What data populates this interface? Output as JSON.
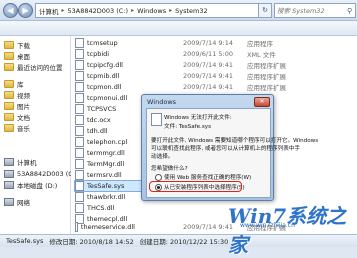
{
  "address": {
    "crumbs": [
      "计算机",
      "53A8842D003 (C:)",
      "Windows",
      "System32"
    ],
    "search_placeholder": "搜索 System32"
  },
  "nav": {
    "items": [
      {
        "label": "下载",
        "type": "folder"
      },
      {
        "label": "桌面",
        "type": "folder"
      },
      {
        "label": "最近访问的位置",
        "type": "folder"
      },
      {
        "label": "库",
        "type": "folder"
      },
      {
        "label": "视频",
        "type": "folder"
      },
      {
        "label": "图片",
        "type": "folder"
      },
      {
        "label": "文档",
        "type": "folder"
      },
      {
        "label": "音乐",
        "type": "folder"
      },
      {
        "label": "计算机",
        "type": "drive"
      },
      {
        "label": "53A8842D003 (C:)",
        "type": "drive"
      },
      {
        "label": "本地磁盘 (D:)",
        "type": "drive"
      },
      {
        "label": "网络",
        "type": "drive"
      }
    ]
  },
  "files": [
    {
      "name": "tcmsetup",
      "date": "2009/7/14 9:14",
      "type": "应用程序",
      "size": ""
    },
    {
      "name": "tcpbidi",
      "date": "2009/6/11 5:00",
      "type": "XML 文件",
      "size": ""
    },
    {
      "name": "tcpipcfg.dll",
      "date": "2009/7/14 9:41",
      "type": "应用程序扩展",
      "size": ""
    },
    {
      "name": "tcpmib.dll",
      "date": "2009/7/14 9:41",
      "type": "应用程序扩展",
      "size": ""
    },
    {
      "name": "tcpmon.dll",
      "date": "2009/7/14 9:41",
      "type": "应用程序扩展",
      "size": ""
    },
    {
      "name": "tcpmonui.dll",
      "date": "",
      "type": "",
      "size": ""
    },
    {
      "name": "TCPSVCS",
      "date": "",
      "type": "",
      "size": ""
    },
    {
      "name": "tdc.ocx",
      "date": "",
      "type": "",
      "size": ""
    },
    {
      "name": "tdh.dll",
      "date": "",
      "type": "",
      "size": ""
    },
    {
      "name": "telephon.cpl",
      "date": "",
      "type": "",
      "size": ""
    },
    {
      "name": "termmgr.dll",
      "date": "",
      "type": "",
      "size": ""
    },
    {
      "name": "TermMgr.dll",
      "date": "",
      "type": "",
      "size": ""
    },
    {
      "name": "termsrv.dll",
      "date": "",
      "type": "",
      "size": ""
    },
    {
      "name": "TesSafe.sys",
      "date": "",
      "type": "",
      "size": ""
    },
    {
      "name": "thawbrkr.dll",
      "date": "",
      "type": "",
      "size": ""
    },
    {
      "name": "THCS.dll",
      "date": "",
      "type": "",
      "size": ""
    },
    {
      "name": "themecpl.dll",
      "date": "",
      "type": "",
      "size": ""
    },
    {
      "name": "themeservice.dll",
      "date": "2009/7/14 9:41",
      "type": "应用程序扩展",
      "size": ""
    },
    {
      "name": "themeui.dll",
      "date": "2009/7/14 9:41",
      "type": "应用程序扩展",
      "size": ""
    }
  ],
  "status": {
    "filename": "TesSafe.sys",
    "modified": "修改日期: 2010/8/18 14:52",
    "created": "创建日期: 2010/12/22 15:30"
  },
  "dialog": {
    "title": "Windows",
    "lines": [
      "Windows 无法打开此文件:",
      "文件:     TesSafe.sys",
      "要打开此文件, Windows 需要知道哪个程序可以打开它。Windows",
      "可以联机查找此程序, 或者您可以从计算机上的程序列表中手",
      "动选择。",
      "您希望做什么?",
      "使用 Web 服务查找正确的程序(W)",
      "从已安装程序列表中选择程序(S)"
    ]
  },
  "watermark": {
    "logo": "Win7系统之家",
    "url": "www.win7zhijia.cn"
  }
}
